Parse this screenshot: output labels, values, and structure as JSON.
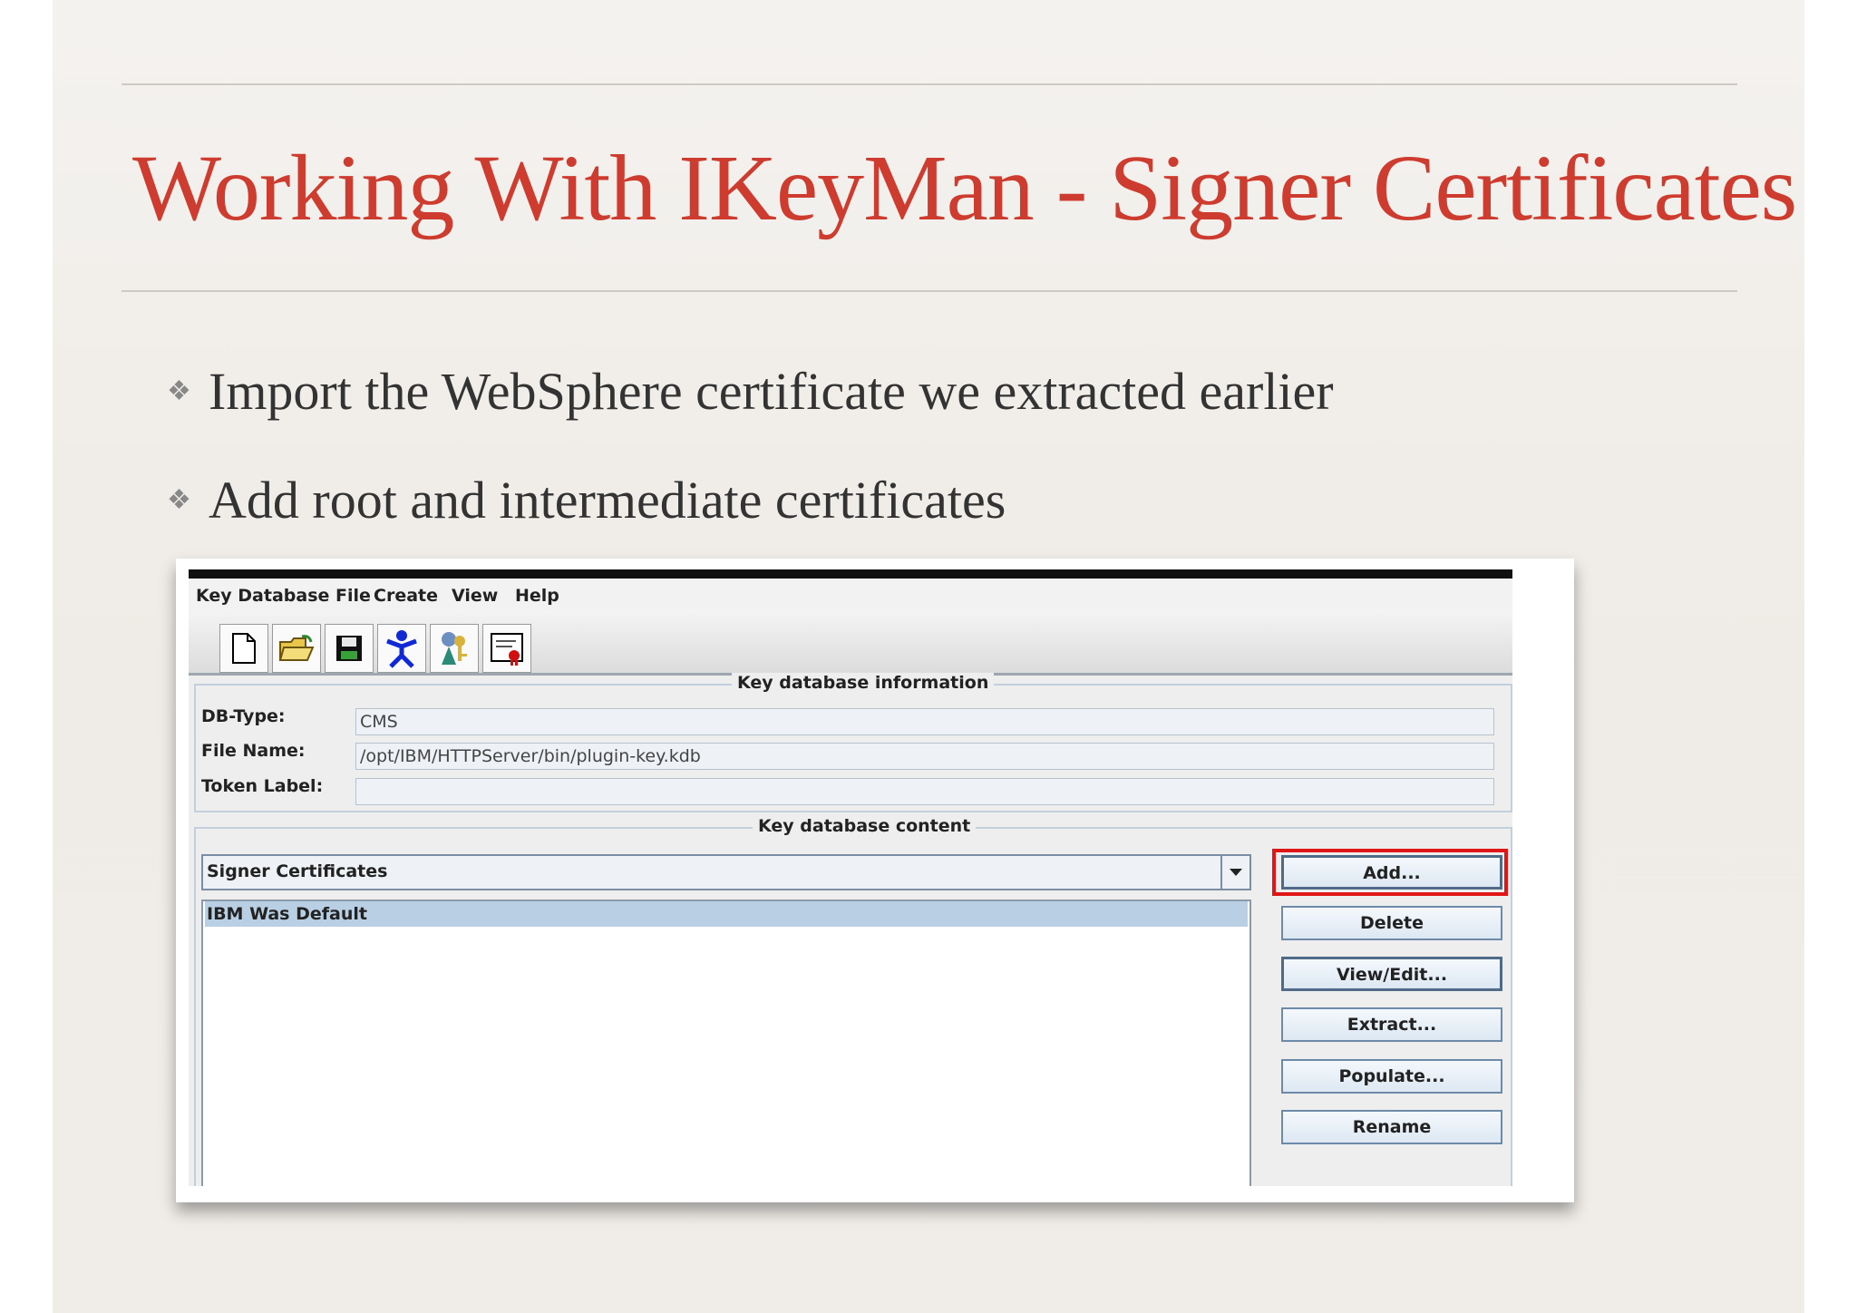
{
  "slide": {
    "title": "Working With IKeyMan - Signer Certificates",
    "bullets": [
      "Import the WebSphere certificate we extracted earlier",
      "Add root and intermediate certificates"
    ],
    "bullet_mark": "❖"
  },
  "app": {
    "menus": [
      "Key Database File",
      "Create",
      "View",
      "Help"
    ],
    "toolbar_icons": [
      "new-file-icon",
      "open-folder-icon",
      "save-icon",
      "person-icon",
      "key-person-icon",
      "certificate-icon"
    ],
    "info_group_title": "Key database information",
    "fields": [
      {
        "label": "DB-Type:",
        "value": "CMS"
      },
      {
        "label": "File Name:",
        "value": "/opt/IBM/HTTPServer/bin/plugin-key.kdb"
      },
      {
        "label": "Token Label:",
        "value": ""
      }
    ],
    "content_group_title": "Key database content",
    "selected_view": "Signer Certificates",
    "list_items": [
      "IBM Was Default"
    ],
    "buttons": [
      "Add...",
      "Delete",
      "View/Edit...",
      "Extract...",
      "Populate...",
      "Rename"
    ],
    "highlight_color": "#e01616"
  }
}
